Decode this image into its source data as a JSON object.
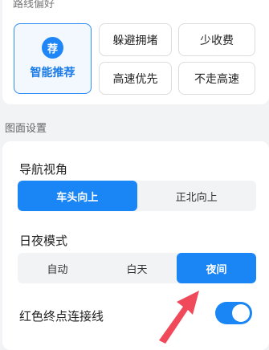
{
  "top_section": {
    "title_cut": "路线偏好",
    "options": [
      {
        "label": "智能推荐",
        "badge": "荐",
        "selected": true
      },
      {
        "label": "躲避拥堵",
        "selected": false
      },
      {
        "label": "少收费",
        "selected": false
      },
      {
        "label": "高速优先",
        "selected": false
      },
      {
        "label": "不走高速",
        "selected": false
      }
    ]
  },
  "map_settings": {
    "section_title": "图面设置",
    "nav_view": {
      "label": "导航视角",
      "options": [
        "车头向上",
        "正北向上"
      ],
      "selected": "车头向上"
    },
    "day_night": {
      "label": "日夜模式",
      "options": [
        "自动",
        "白天",
        "夜间"
      ],
      "selected": "夜间"
    },
    "red_endpoint_line": {
      "label": "红色终点连接线",
      "enabled": true
    }
  },
  "colors": {
    "accent": "#1a86f5",
    "annotation_arrow": "#f04a5a"
  }
}
